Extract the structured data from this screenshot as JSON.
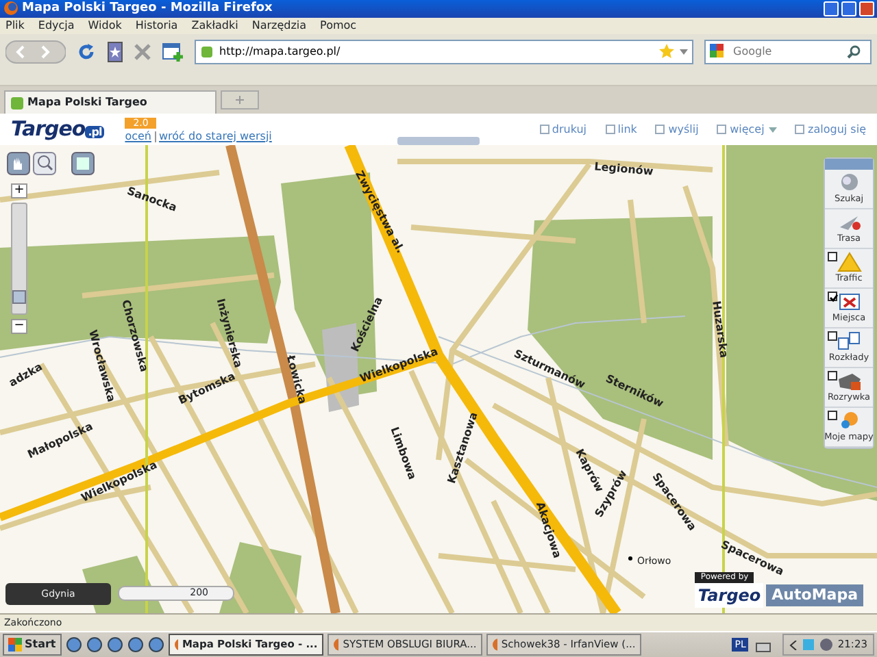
{
  "window": {
    "title": "Mapa Polski Targeo - Mozilla Firefox"
  },
  "menu": [
    "Plik",
    "Edycja",
    "Widok",
    "Historia",
    "Zakładki",
    "Narzędzia",
    "Pomoc"
  ],
  "address_bar": {
    "url": "http://mapa.targeo.pl/"
  },
  "search": {
    "placeholder": "Google"
  },
  "tabs": [
    {
      "label": "Mapa Polski Targeo",
      "selected": true
    }
  ],
  "page_header": {
    "logo": "Targeo",
    "logo_suffix": ".pl",
    "version_badge": "2.0",
    "links": [
      "oceń",
      "wróć do starej wersji"
    ],
    "actions": [
      {
        "label": "drukuj",
        "dropdown": false
      },
      {
        "label": "link",
        "dropdown": false
      },
      {
        "label": "wyślij",
        "dropdown": false
      },
      {
        "label": "więcej",
        "dropdown": true
      },
      {
        "label": "zaloguj się",
        "dropdown": false
      }
    ]
  },
  "map": {
    "street_labels": [
      "Legionów",
      "Sanocka",
      "Zwycięstwa al.",
      "Kościelna",
      "Łowicka",
      "Wrocławska",
      "Chorzowska",
      "Inżynierska",
      "Bytomska",
      "Wielkopolska",
      "Małopolska",
      "Wielkopolska",
      "Limbowa",
      "Kasztanowa",
      "Szturmanów",
      "Sterników",
      "Kaprów",
      "Szyprów",
      "Spacerowa",
      "Spacerowa",
      "Akacjowa",
      "Huzarska",
      "adzka"
    ],
    "place_label": "Orłowo",
    "zoom": {
      "level": 0.1,
      "zoom_in": "+",
      "zoom_out": "−"
    },
    "city_select": "Gdynia",
    "scale": "200",
    "powered_by": "Powered by",
    "brand": "Targeo",
    "partner": "AutoMapa"
  },
  "layers": [
    {
      "label": "Szukaj",
      "kind": "button"
    },
    {
      "label": "Trasa",
      "kind": "button"
    },
    {
      "label": "Traffic",
      "kind": "toggle",
      "checked": false
    },
    {
      "label": "Miejsca",
      "kind": "toggle",
      "checked": true
    },
    {
      "label": "Rozkłady",
      "kind": "toggle",
      "checked": false
    },
    {
      "label": "Rozrywka",
      "kind": "toggle",
      "checked": false
    },
    {
      "label": "Moje mapy",
      "kind": "toggle",
      "checked": false
    }
  ],
  "status_bar": "Zakończono",
  "taskbar": {
    "start": "Start",
    "tasks": [
      {
        "label": "Mapa Polski Targeo - ...",
        "selected": true
      },
      {
        "label": "SYSTEM OBSLUGI BIURA...",
        "selected": false
      },
      {
        "label": "Schowek38 - IrfanView (...",
        "selected": false
      }
    ],
    "language": "PL",
    "clock": "21:23"
  }
}
